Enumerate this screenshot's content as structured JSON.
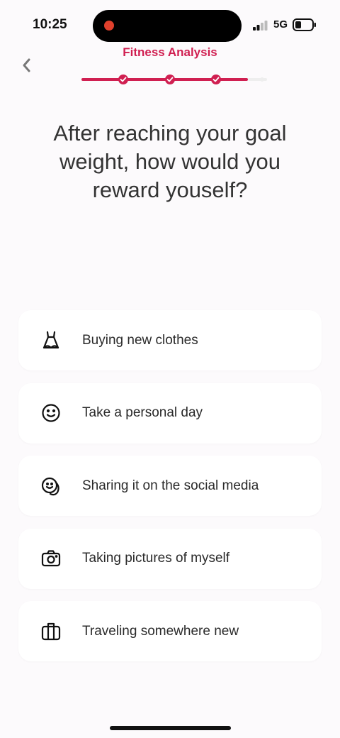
{
  "status": {
    "time": "10:25",
    "network": "5G"
  },
  "header": {
    "title": "Fitness Analysis",
    "progress_steps_total": 4,
    "progress_steps_done": 3
  },
  "question": "After reaching your goal weight, how would you reward youself?",
  "options": [
    {
      "icon": "dress-icon",
      "label": "Buying new clothes"
    },
    {
      "icon": "smiley-icon",
      "label": "Take a personal day"
    },
    {
      "icon": "social-share-icon",
      "label": "Sharing it on the social media"
    },
    {
      "icon": "camera-icon",
      "label": "Taking pictures of myself"
    },
    {
      "icon": "suitcase-icon",
      "label": "Traveling somewhere new"
    }
  ],
  "colors": {
    "accent": "#d01f51",
    "background": "#fcfafc",
    "card": "#ffffff"
  }
}
